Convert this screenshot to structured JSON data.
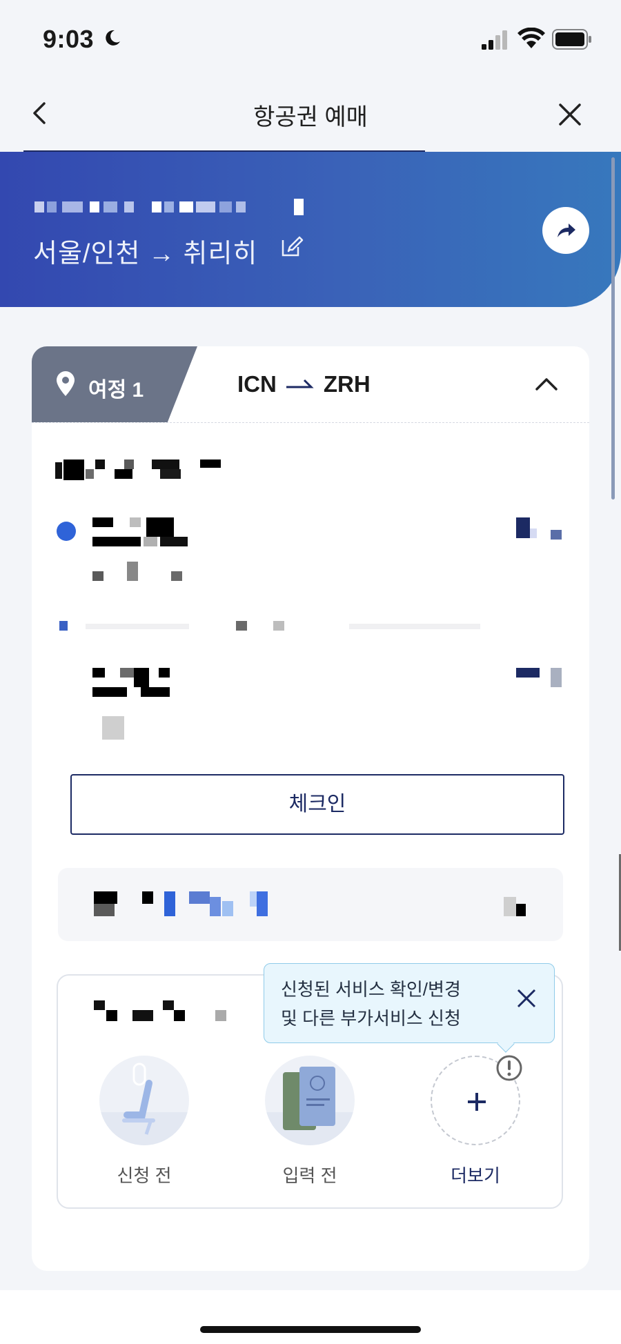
{
  "status_bar": {
    "time": "9:03"
  },
  "nav": {
    "title": "항공권 예매",
    "back_icon": "chevron-left-icon",
    "close_icon": "close-icon"
  },
  "hero": {
    "route_text": "서울/인천 → 취리히",
    "share_icon": "share-icon",
    "edit_icon": "edit-icon"
  },
  "trip": {
    "label": "여정 1",
    "origin": "ICN",
    "destination": "ZRH"
  },
  "checkin": {
    "label": "체크인"
  },
  "tooltip": {
    "line1": "신청된 서비스 확인/변경",
    "line2": "및 다른 부가서비스 신청"
  },
  "services": [
    {
      "label": "신청 전",
      "icon": "seat-icon"
    },
    {
      "label": "입력 전",
      "icon": "passport-icon"
    },
    {
      "label": "더보기",
      "icon": "plus-icon"
    }
  ],
  "colors": {
    "hero_start": "#3348b0",
    "hero_end": "#3778bd",
    "navy": "#1c2a63",
    "tab_gray": "#6b7488"
  }
}
